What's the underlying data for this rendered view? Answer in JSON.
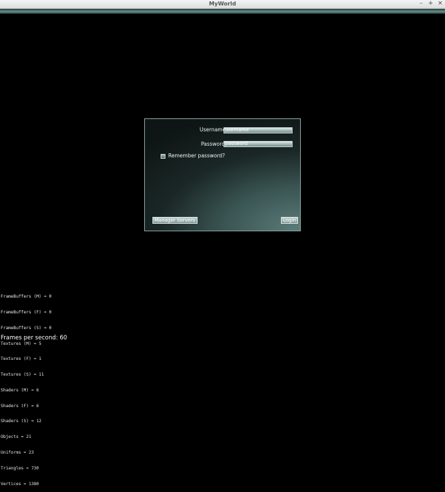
{
  "window": {
    "title": "MyWorld",
    "minimize": "–",
    "maximize": "+",
    "close": "×"
  },
  "login": {
    "username_label": "Username:",
    "username_value": "username",
    "password_label": "Password:",
    "password_value": "password",
    "remember_label": "Remember password?",
    "remember_checked": false,
    "manager_servers_label": "Manager Servers",
    "login_label": "Login"
  },
  "stats": [
    "FrameBuffers (M) = 0",
    "FrameBuffers (F) = 0",
    "FrameBuffers (S) = 0",
    "Textures (M) = 5",
    "Textures (F) = 1",
    "Textures (S) = 11",
    "Shaders (M) = 6",
    "Shaders (F) = 6",
    "Shaders (S) = 12",
    "Objects = 21",
    "Uniforms = 23",
    "Triangles = 730",
    "Vertices = 1380"
  ],
  "fps": "Frames per second: 60"
}
